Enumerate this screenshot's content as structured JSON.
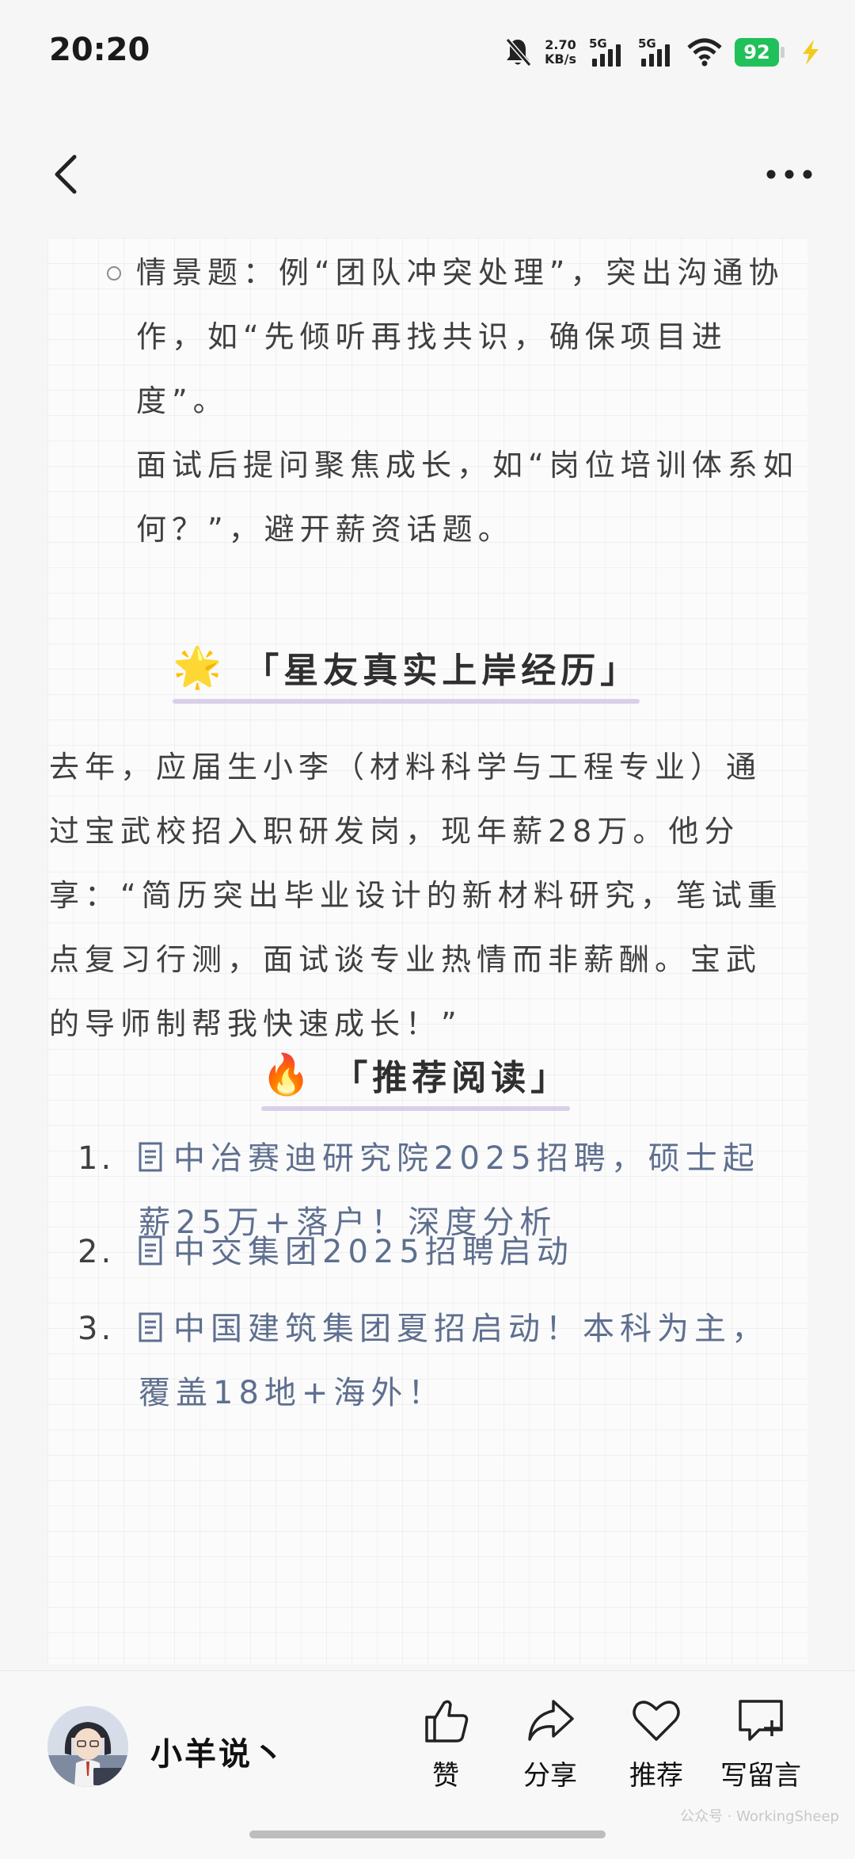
{
  "status": {
    "time": "20:20",
    "net_speed_value": "2.70",
    "net_speed_unit": "KB/s",
    "sim1": "5G",
    "sim2": "5G",
    "battery": "92"
  },
  "article": {
    "scenario_text": "情景题：例“团队冲突处理”，突出沟通协作，如“先倾听再找共识，确保项目进度”。",
    "after_interview_text": "面试后提问聚焦成长，如“岗位培训体系如何？”，避开薪资话题。",
    "story_heading": "「星友真实上岸经历」",
    "story_emoji": "🌟",
    "story_text": "去年，应届生小李（材料科学与工程专业）通过宝武校招入职研发岗，现年薪28万。他分享：“简历突出毕业设计的新材料研究，笔试重点复习行测，面试谈专业热情而非薪酬。宝武的导师制帮我快速成长！”",
    "rec_heading": "「推荐阅读」",
    "rec_emoji": "🔥",
    "recommendations": [
      {
        "num": "1.",
        "title": "中冶赛迪研究院2025招聘，硕士起薪25万+落户！深度分析"
      },
      {
        "num": "2.",
        "title": "中交集团2025招聘启动"
      },
      {
        "num": "3.",
        "title": "中国建筑集团夏招启动！本科为主，覆盖18地+海外！"
      }
    ]
  },
  "bottom": {
    "author": "小羊说丶",
    "like": "赞",
    "share": "分享",
    "recommend": "推荐",
    "comment": "写留言",
    "watermark": "公众号 · WorkingSheep"
  }
}
